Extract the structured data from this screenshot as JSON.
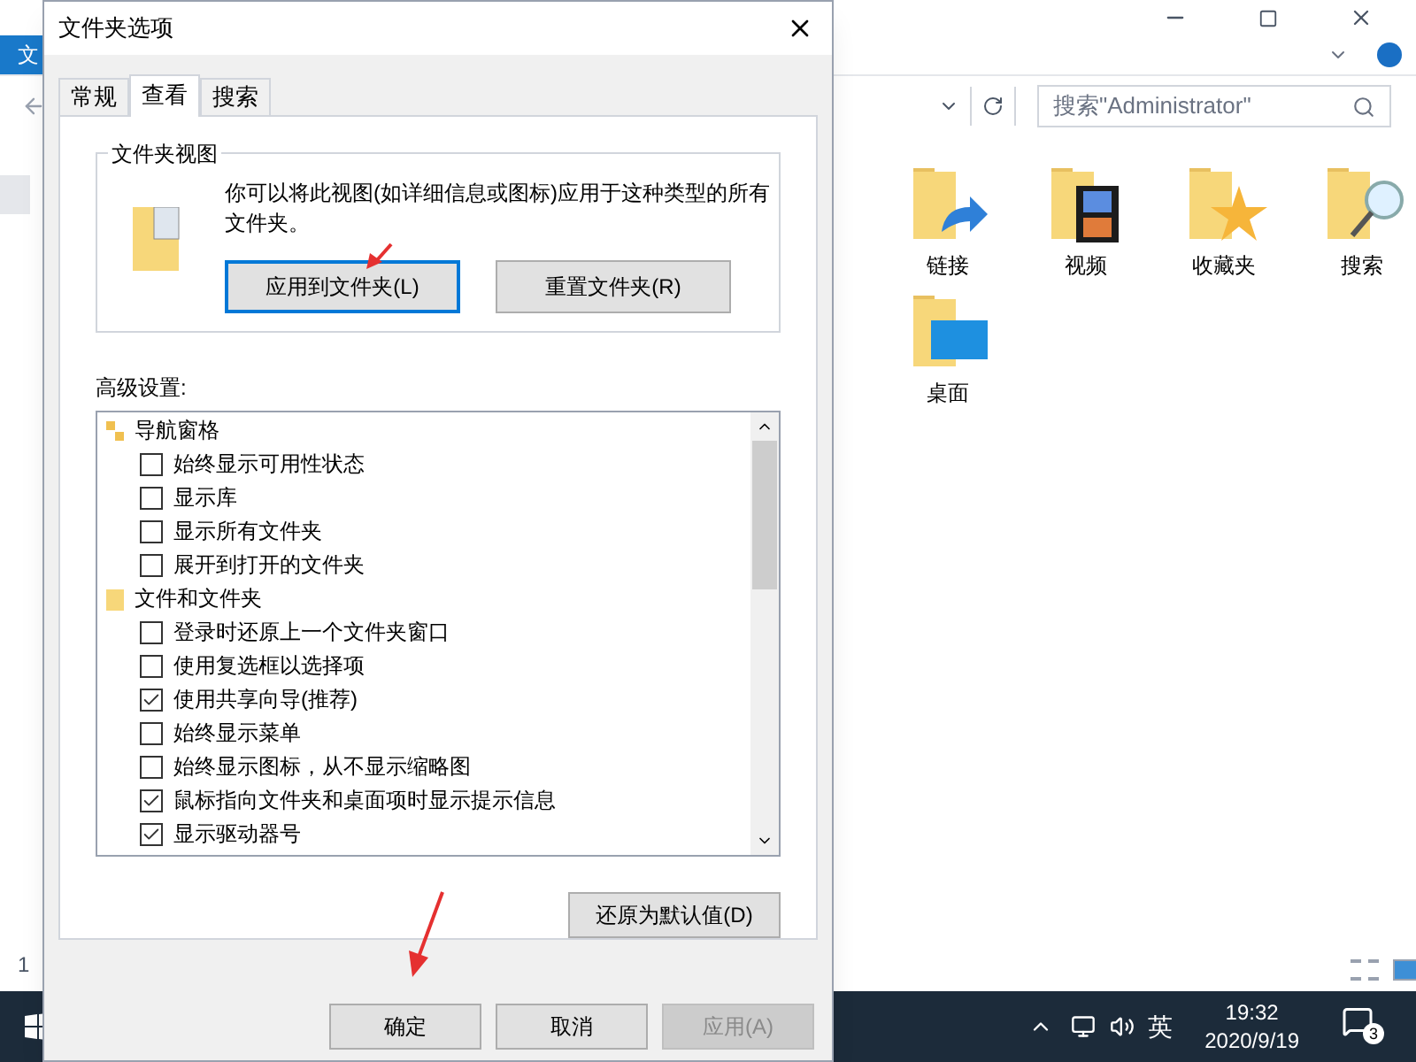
{
  "explorer": {
    "ribbon_tab": "文",
    "search_placeholder": "搜索\"Administrator\"",
    "status": "1",
    "items": [
      {
        "kind": "link",
        "label": "链接"
      },
      {
        "kind": "video",
        "label": "视频"
      },
      {
        "kind": "star",
        "label": "收藏夹"
      },
      {
        "kind": "search",
        "label": "搜索"
      },
      {
        "kind": "desktop",
        "label": "桌面"
      }
    ]
  },
  "dialog": {
    "title": "文件夹选项",
    "tabs": [
      {
        "label": "常规",
        "selected": false
      },
      {
        "label": "查看",
        "selected": true
      },
      {
        "label": "搜索",
        "selected": false
      }
    ],
    "folder_views": {
      "title": "文件夹视图",
      "description": "你可以将此视图(如详细信息或图标)应用于这种类型的所有文件夹。",
      "buttons": [
        {
          "label": "应用到文件夹(L)",
          "focused": true
        },
        {
          "label": "重置文件夹(R)",
          "focused": false
        }
      ]
    },
    "advanced": {
      "title": "高级设置:",
      "groups": [
        {
          "kind": "nav",
          "label": "导航窗格",
          "children": [
            {
              "label": "始终显示可用性状态",
              "checked": false
            },
            {
              "label": "显示库",
              "checked": false
            },
            {
              "label": "显示所有文件夹",
              "checked": false
            },
            {
              "label": "展开到打开的文件夹",
              "checked": false
            }
          ]
        },
        {
          "kind": "folder",
          "label": "文件和文件夹",
          "children": [
            {
              "label": "登录时还原上一个文件夹窗口",
              "checked": false
            },
            {
              "label": "使用复选框以选择项",
              "checked": false
            },
            {
              "label": "使用共享向导(推荐)",
              "checked": true
            },
            {
              "label": "始终显示菜单",
              "checked": false
            },
            {
              "label": "始终显示图标，从不显示缩略图",
              "checked": false
            },
            {
              "label": "鼠标指向文件夹和桌面项时显示提示信息",
              "checked": true
            },
            {
              "label": "显示驱动器号",
              "checked": true
            }
          ]
        }
      ]
    },
    "restore_button": "还原为默认值(D)",
    "buttons": [
      {
        "label": "确定",
        "disabled": false
      },
      {
        "label": "取消",
        "disabled": false
      },
      {
        "label": "应用(A)",
        "disabled": true
      }
    ]
  },
  "taskbar": {
    "ime": "英",
    "time": "19:32",
    "date": "2020/9/19",
    "notifications": "3"
  }
}
